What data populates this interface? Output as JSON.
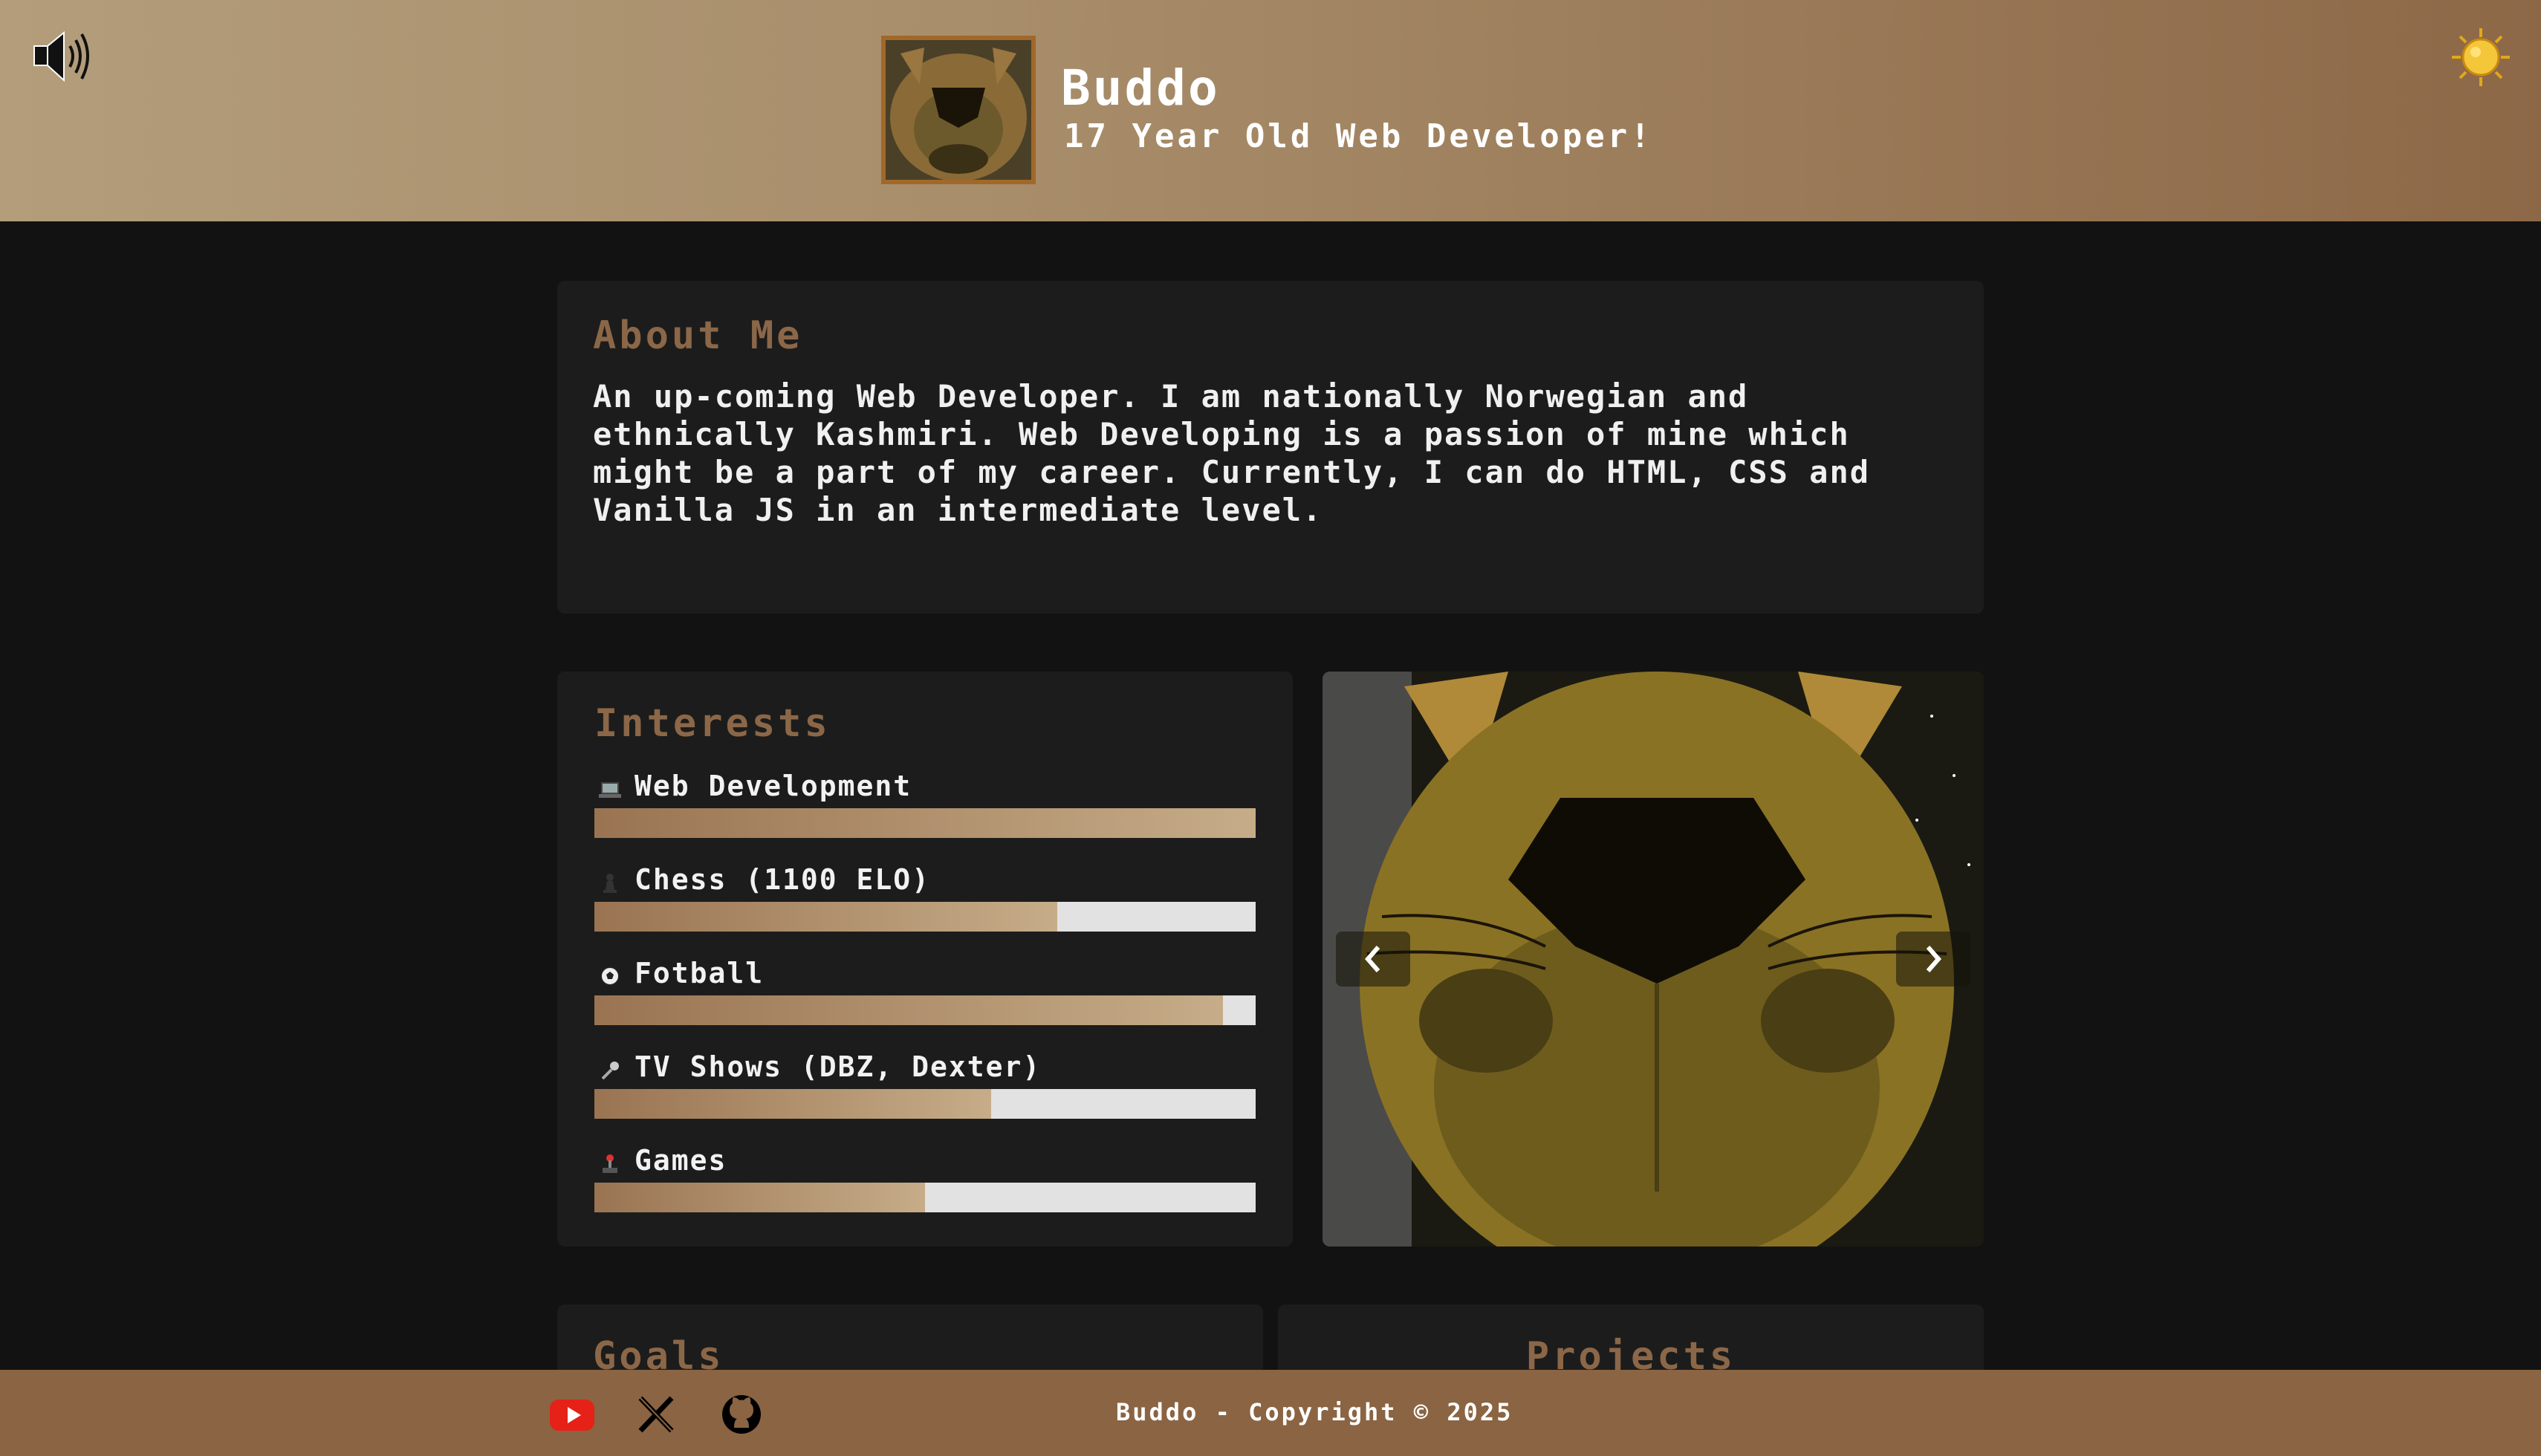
{
  "header": {
    "name": "Buddo",
    "tagline": "17 Year Old Web Developer!",
    "sound_icon": "speaker-icon",
    "theme_icon": "sun-icon"
  },
  "about": {
    "title": "About Me",
    "text": "An up-coming Web Developer. I am nationally Norwegian and ethnically Kashmiri. Web Developing is a passion of mine which might be a part of my career. Currently, I can do HTML, CSS and Vanilla JS in an intermediate level."
  },
  "interests": {
    "title": "Interests",
    "items": [
      {
        "icon": "laptop-icon",
        "label": "Web Development",
        "level": 1.0
      },
      {
        "icon": "chess-pawn-icon",
        "label": "Chess (1100 ELO)",
        "level": 0.7
      },
      {
        "icon": "football-icon",
        "label": "Fotball",
        "level": 0.95
      },
      {
        "icon": "microphone-icon",
        "label": "TV Shows (DBZ, Dexter)",
        "level": 0.6
      },
      {
        "icon": "joystick-icon",
        "label": "Games",
        "level": 0.5
      }
    ]
  },
  "goals": {
    "title": "Goals"
  },
  "projects": {
    "title": "Projects"
  },
  "footer": {
    "copyright": "Buddo - Copyright © 2025",
    "social": [
      "youtube-icon",
      "x-icon",
      "github-icon"
    ]
  },
  "colors": {
    "accent": "#8b6748",
    "footer": "#8a6443",
    "youtube": "#e62117"
  }
}
